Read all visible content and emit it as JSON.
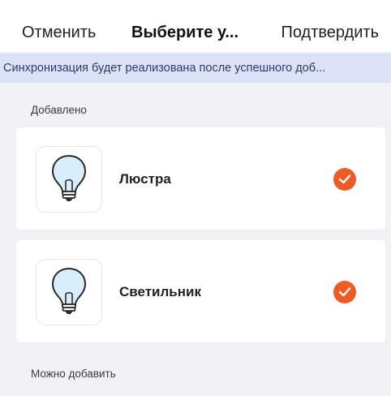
{
  "nav": {
    "cancel_label": "Отменить",
    "title": "Выберите у...",
    "confirm_label": "Подтвердить"
  },
  "banner": {
    "text": "Синхронизация будет реализована после успешного доб..."
  },
  "sections": {
    "added_label": "Добавлено",
    "can_add_label": "Можно добавить"
  },
  "devices": [
    {
      "name": "Люстра",
      "icon": "light-bulb-icon",
      "checked": true
    },
    {
      "name": "Светильник",
      "icon": "light-bulb-icon",
      "checked": true
    }
  ],
  "colors": {
    "accent": "#ef5b25",
    "banner_bg": "#dde3f7",
    "banner_text": "#2d3a66",
    "page_bg": "#f2f2f4",
    "bulb_fill": "#d9eefb"
  }
}
